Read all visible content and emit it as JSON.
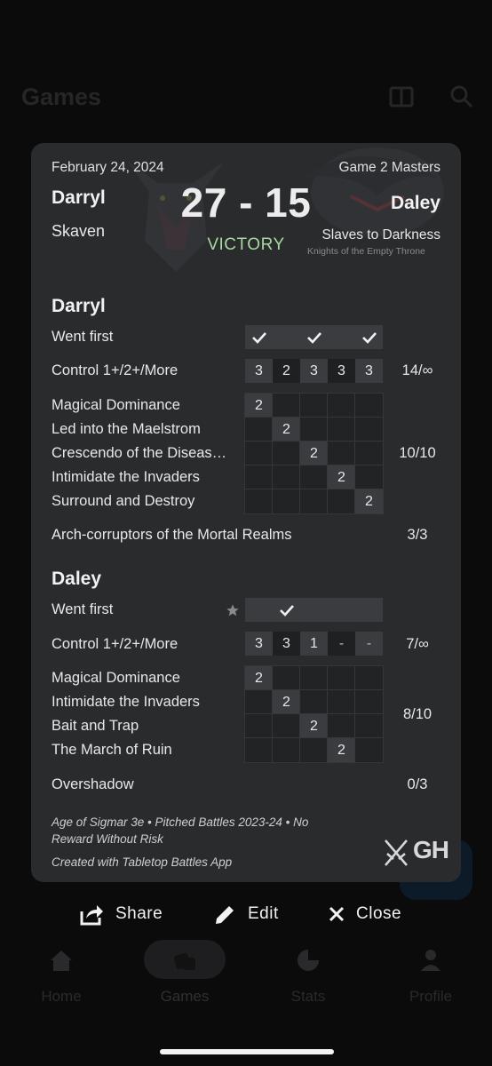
{
  "background": {
    "title": "Games",
    "nav": [
      {
        "label": "Home",
        "icon": "home-icon"
      },
      {
        "label": "Games",
        "icon": "dice-icon"
      },
      {
        "label": "Stats",
        "icon": "pie-chart-icon"
      },
      {
        "label": "Profile",
        "icon": "profile-icon"
      }
    ]
  },
  "card": {
    "date": "February 24, 2024",
    "game_name": "Game 2 Masters",
    "player1": {
      "name": "Darryl",
      "faction": "Skaven"
    },
    "score": "27 - 15",
    "result": "VICTORY",
    "player2": {
      "name": "Daley",
      "faction": "Slaves to Darkness",
      "subfaction": "Knights of the Empty Throne"
    },
    "sections": [
      {
        "name": "Darryl",
        "went_first_label": "Went first",
        "went_first": [
          true,
          false,
          true,
          false,
          true
        ],
        "control_label": "Control 1+/2+/More",
        "control": [
          "3",
          "2",
          "3",
          "3",
          "3"
        ],
        "control_total": "14/∞",
        "tactics": [
          {
            "name": "Magical Dominance",
            "round": 1,
            "value": "2"
          },
          {
            "name": "Led into the Maelstrom",
            "round": 2,
            "value": "2"
          },
          {
            "name": "Crescendo of the Diseas…",
            "round": 3,
            "value": "2"
          },
          {
            "name": "Intimidate the Invaders",
            "round": 4,
            "value": "2"
          },
          {
            "name": "Surround and Destroy",
            "round": 5,
            "value": "2"
          }
        ],
        "tactics_total": "10/10",
        "grand_strategy": "Arch-corruptors of the Mortal Realms",
        "grand_strategy_total": "3/3"
      },
      {
        "name": "Daley",
        "went_first_label": "Went first",
        "went_first": [
          false,
          true,
          false,
          false,
          false
        ],
        "control_label": "Control 1+/2+/More",
        "control": [
          "3",
          "3",
          "1",
          "-",
          "-"
        ],
        "control_total": "7/∞",
        "tactics": [
          {
            "name": "Magical Dominance",
            "round": 1,
            "value": "2"
          },
          {
            "name": "Intimidate the Invaders",
            "round": 2,
            "value": "2"
          },
          {
            "name": "Bait and Trap",
            "round": 3,
            "value": "2"
          },
          {
            "name": "The March of Ruin",
            "round": 4,
            "value": "2"
          }
        ],
        "tactics_total": "8/10",
        "grand_strategy": "Overshadow",
        "grand_strategy_total": "0/3"
      }
    ],
    "footer_line1": "Age of Sigmar 3e • Pitched Battles 2023-24 • No",
    "footer_line2": "Reward Without Risk",
    "footer_credit": "Created with Tabletop Battles App",
    "logo_text": "GH"
  },
  "actions": {
    "share": "Share",
    "edit": "Edit",
    "close": "Close"
  },
  "colors": {
    "victory": "#a7d8a2",
    "card_bg": "#2a2b2d",
    "cell_bg": "#3b3c3f"
  }
}
